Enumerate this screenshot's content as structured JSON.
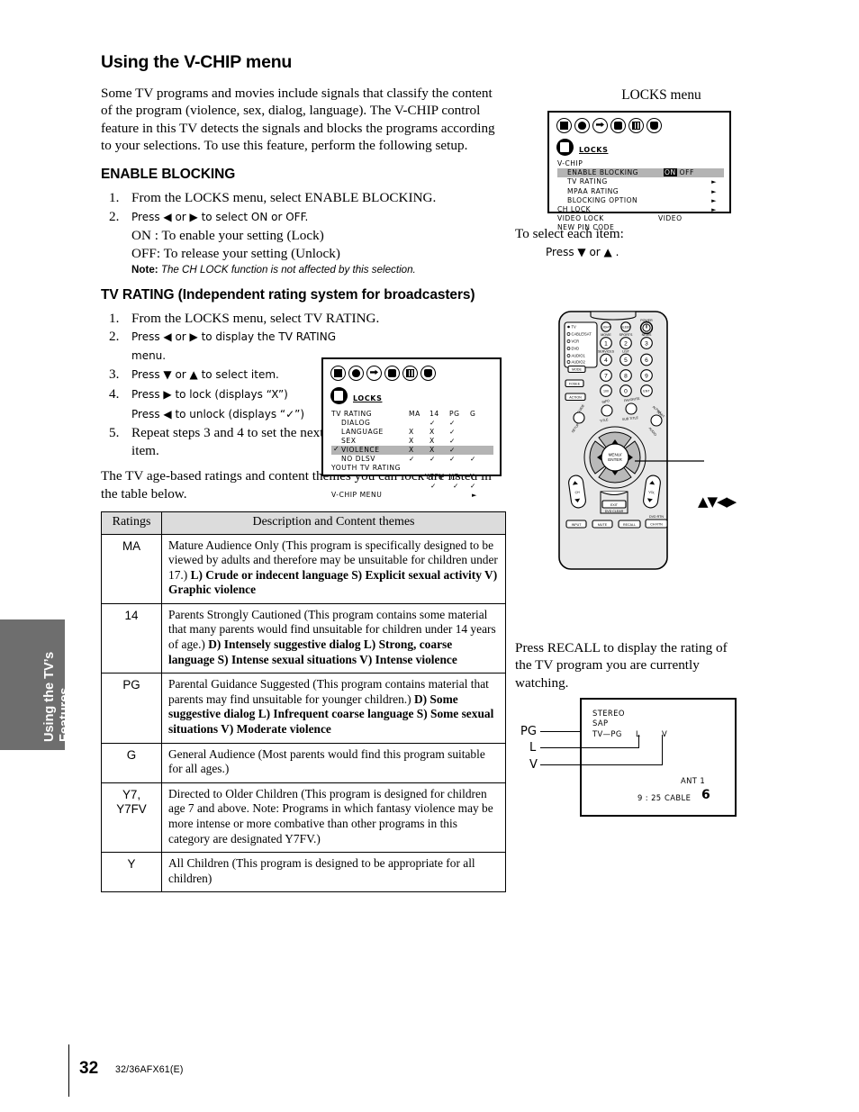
{
  "page": {
    "number": "32",
    "model": "32/36AFX61(E)",
    "side_tab": "Using the TV’s Features"
  },
  "left": {
    "title": "Using the V-CHIP menu",
    "intro": "Some TV programs and movies include signals that classify the content of the program (violence, sex, dialog, language). The V-CHIP control feature in this TV detects the signals and blocks the programs according to your selections. To use this feature, perform the following setup.",
    "enable_heading": "ENABLE BLOCKING",
    "enable_steps": [
      {
        "num": "1.",
        "text": "From the LOCKS menu, select ENABLE BLOCKING."
      },
      {
        "num": "2.",
        "text": "Press ◀ or ▶ to select ON or OFF."
      }
    ],
    "enable_on": "ON : To enable your setting (Lock)",
    "enable_off": "OFF: To release your setting (Unlock)",
    "note_label": "Note:",
    "note_text": "The CH LOCK function is not affected by this selection.",
    "tvrating_heading": "TV RATING (Independent rating system for broadcasters)",
    "tvrating_steps": [
      {
        "num": "1.",
        "text": "From the LOCKS menu, select TV RATING."
      },
      {
        "num": "2.",
        "text": "Press ◀ or ▶ to display the TV RATING menu."
      },
      {
        "num": "3.",
        "text": "Press ▼ or ▲ to select item."
      },
      {
        "num": "4.",
        "text": "Press ▶ to lock (displays “X”)"
      },
      {
        "num": "5.",
        "text": "Repeat steps 3 and 4 to set the next item."
      }
    ],
    "tvrating_step4b": "Press ◀ to unlock (displays “✓”)",
    "table_intro": "The TV age-based ratings and content themes you can lock are listed in the table below."
  },
  "table": {
    "headers": [
      "Ratings",
      "Description and Content themes"
    ],
    "rows": [
      {
        "rating": "MA",
        "desc": "Mature Audience Only (This program is specifically designed to be viewed by adults and therefore may be unsuitable for children under 17.)",
        "bold": "L) Crude or indecent language  S) Explicit sexual activity V) Graphic violence"
      },
      {
        "rating": "14",
        "desc": "Parents Strongly Cautioned (This program contains some material that many parents would find unsuitable for children under 14 years of age.)",
        "bold": "D) Intensely suggestive dialog  L) Strong, coarse language S) Intense sexual situations  V) Intense violence"
      },
      {
        "rating": "PG",
        "desc": "Parental Guidance Suggested (This program contains material that parents may find unsuitable for younger children.)",
        "bold": "D) Some suggestive dialog  L) Infrequent coarse language S) Some sexual situations  V) Moderate violence"
      },
      {
        "rating": "G",
        "desc": "General Audience (Most parents would find this program suitable for all ages.)",
        "bold": ""
      },
      {
        "rating": "Y7, Y7FV",
        "desc": "Directed to Older Children (This program is designed for children age 7 and above. Note: Programs in which fantasy violence may be more intense or more combative than other programs in this category are designated Y7FV.)",
        "bold": ""
      },
      {
        "rating": "Y",
        "desc": "All Children (This program is designed to be appropriate for all children)",
        "bold": ""
      }
    ]
  },
  "locks_menu": {
    "caption": "LOCKS menu",
    "header_label": "LOCKS",
    "rows": [
      {
        "label": "V-CHIP",
        "value": "",
        "arrow": false,
        "highlight": false,
        "indent": false
      },
      {
        "label": "ENABLE BLOCKING",
        "value": "ON OFF",
        "arrow": false,
        "highlight": true,
        "indent": true
      },
      {
        "label": "TV RATING",
        "value": "",
        "arrow": true,
        "highlight": false,
        "indent": true
      },
      {
        "label": "MPAA RATING",
        "value": "",
        "arrow": true,
        "highlight": false,
        "indent": true
      },
      {
        "label": "BLOCKING OPTION",
        "value": "",
        "arrow": true,
        "highlight": false,
        "indent": true
      },
      {
        "label": "CH LOCK",
        "value": "",
        "arrow": true,
        "highlight": false,
        "indent": false
      },
      {
        "label": "VIDEO LOCK",
        "value": "VIDEO",
        "arrow": false,
        "highlight": false,
        "indent": false
      },
      {
        "label": "NEW PIN CODE",
        "value": "",
        "arrow": false,
        "highlight": false,
        "indent": false
      }
    ],
    "on_text": "ON",
    "off_text": "OFF",
    "select_text": "To select each item:",
    "select_press": "Press ▼ or ▲ ."
  },
  "tv_rating_menu": {
    "header_label": "LOCKS",
    "title_row": {
      "label": "TV RATING",
      "cols": [
        "MA",
        "14",
        "PG",
        "G"
      ]
    },
    "rows": [
      {
        "label": "DIALOG",
        "marks": [
          "",
          "✓",
          "✓",
          ""
        ],
        "highlight": false
      },
      {
        "label": "LANGUAGE",
        "marks": [
          "X",
          "X",
          "✓",
          ""
        ],
        "highlight": false
      },
      {
        "label": "SEX",
        "marks": [
          "X",
          "X",
          "✓",
          ""
        ],
        "highlight": false
      },
      {
        "label": "VIOLENCE",
        "marks": [
          "X",
          "X",
          "✓",
          ""
        ],
        "highlight": true
      },
      {
        "label": "NO DLSV",
        "marks": [
          "✓",
          "✓",
          "✓",
          "✓"
        ],
        "highlight": false
      }
    ],
    "youth_label": "YOUTH TV RATING",
    "youth_cols": [
      "Y7FV",
      "Y7",
      "Y"
    ],
    "youth_marks": [
      "✓",
      "✓",
      "✓"
    ],
    "footer_label": "V-CHIP MENU"
  },
  "remote": {
    "modes": [
      "TV",
      "CABLE/SAT",
      "VCR",
      "DVD",
      "AUDIO1",
      "AUDIO2"
    ],
    "mode_button": "MODE",
    "fosee_button": "FOSEE",
    "action_button": "ACTION",
    "top_buttons": [
      "LIGHT",
      "SLEEP",
      "POWER"
    ],
    "number_labels": [
      "MOVIE",
      "SPORTS",
      "NEWS",
      "SERVICES",
      "LIST"
    ],
    "numbers": [
      "1",
      "2",
      "3",
      "4",
      "5",
      "6",
      "7",
      "8",
      "9",
      "100",
      "0",
      "ENT"
    ],
    "round_labels": [
      "INFO",
      "FAVORITE",
      "TITLE",
      "SUB TITLE",
      "GUIDE",
      "SETUP",
      "ALPHA SORT",
      "AUDIO"
    ],
    "menu_enter": "MENU/\nENTER",
    "ch_label": "CH",
    "vol_label": "VOL",
    "exit_button": "EXIT",
    "dvd_clear": "DVD CLEAR",
    "bottom_buttons": [
      "INPUT",
      "MUTE",
      "RECALL",
      "CH RTN"
    ],
    "dvd_rtn": "DVD RTN",
    "callout": "▲▼◀▶"
  },
  "recall": {
    "text": "Press RECALL to display the rating of the TV program you are currently watching.",
    "osd": {
      "stereo": "STEREO",
      "sap": "SAP",
      "rating": "TV—PG",
      "content_l": "L",
      "content_v": "V",
      "ant": "ANT  1",
      "time": "9 : 25",
      "source": "CABLE",
      "channel": "6"
    },
    "leads": [
      "PG",
      "L",
      "V"
    ]
  }
}
